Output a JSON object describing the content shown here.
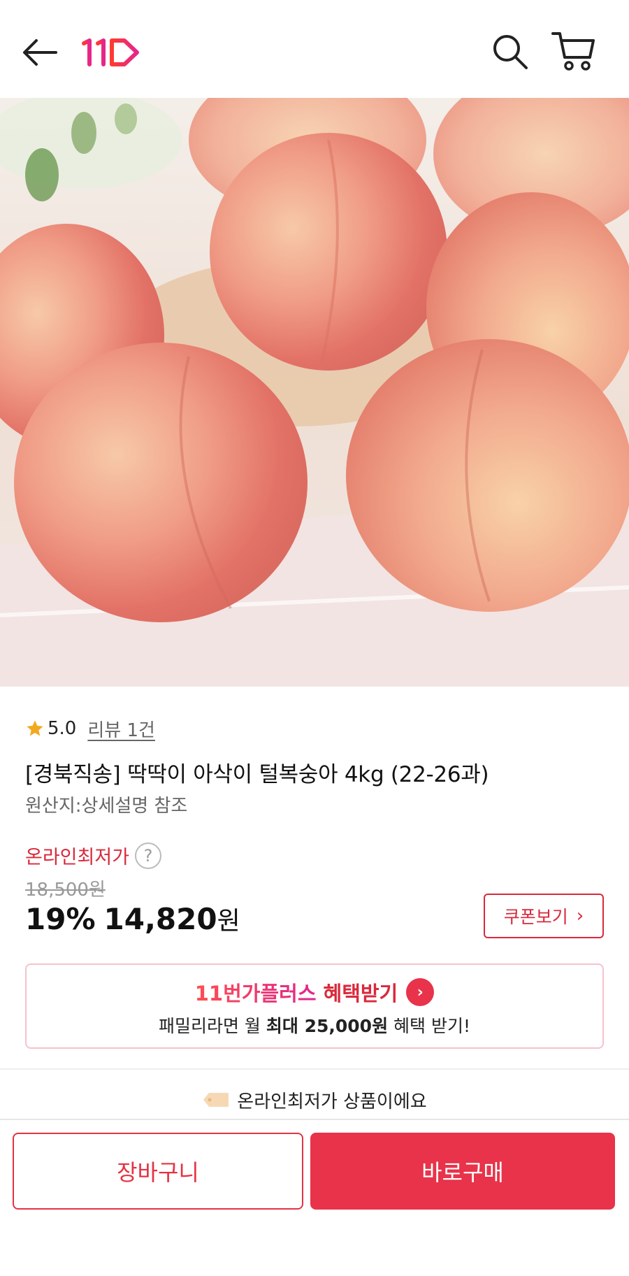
{
  "header": {
    "back_icon": "arrow-left-icon",
    "logo_text": "11",
    "search_icon": "search-icon",
    "cart_icon": "cart-icon"
  },
  "product": {
    "rating": "5.0",
    "review_link": "리뷰 1건",
    "title": "[경북직송] 딱딱이 아삭이 털복숭아 4kg (22-26과)",
    "origin": "원산지:상세설명 참조",
    "lowest_price_label": "온라인최저가",
    "help_symbol": "?",
    "original_price": "18,500원",
    "discount": "19%",
    "sale_price": "14,820",
    "currency": "원",
    "coupon_button": "쿠폰보기",
    "coupon_chevron": "›"
  },
  "plus_banner": {
    "brand": "11번가플러스",
    "action": "혜택받기",
    "chevron": "›",
    "sub_prefix": "패밀리라면 월 ",
    "sub_bold": "최대 25,000원",
    "sub_suffix": " 혜택 받기!"
  },
  "notice": {
    "text": "온라인최저가 상품이에요"
  },
  "bottom": {
    "cart_label": "장바구니",
    "buy_label": "바로구매"
  },
  "colors": {
    "brand_red": "#e8334a",
    "text_red": "#d9293c"
  }
}
